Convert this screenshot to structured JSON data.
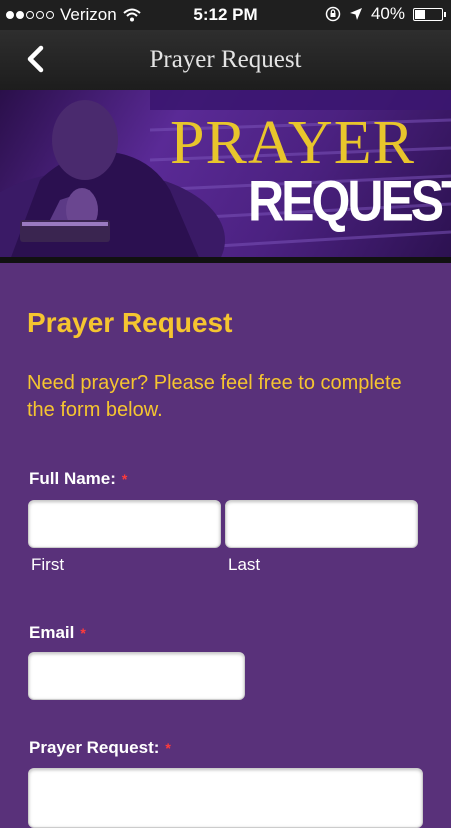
{
  "status_bar": {
    "carrier": "Verizon",
    "time": "5:12 PM",
    "battery": "40%",
    "battery_level": 0.4
  },
  "nav": {
    "title": "Prayer Request"
  },
  "banner": {
    "title_line1": "PRAYER",
    "title_line2": "REQUEST"
  },
  "form": {
    "heading": "Prayer Request",
    "intro": "Need prayer? Please feel free to complete the form below.",
    "full_name": {
      "label": "Full Name:",
      "required_mark": "*",
      "first_label": "First",
      "last_label": "Last",
      "first_value": "",
      "last_value": ""
    },
    "email": {
      "label": "Email",
      "required_mark": "*",
      "value": ""
    },
    "prayer_request": {
      "label": "Prayer Request:",
      "required_mark": "*",
      "value": ""
    }
  },
  "colors": {
    "background": "#59317a",
    "accent_gold": "#f5c530",
    "required_red": "#ff3b3b",
    "nav_bar": "#1f1f1f"
  },
  "icons": [
    "signal-dots-icon",
    "wifi-icon",
    "rotation-lock-icon",
    "location-arrow-icon",
    "battery-icon",
    "back-chevron-icon"
  ]
}
